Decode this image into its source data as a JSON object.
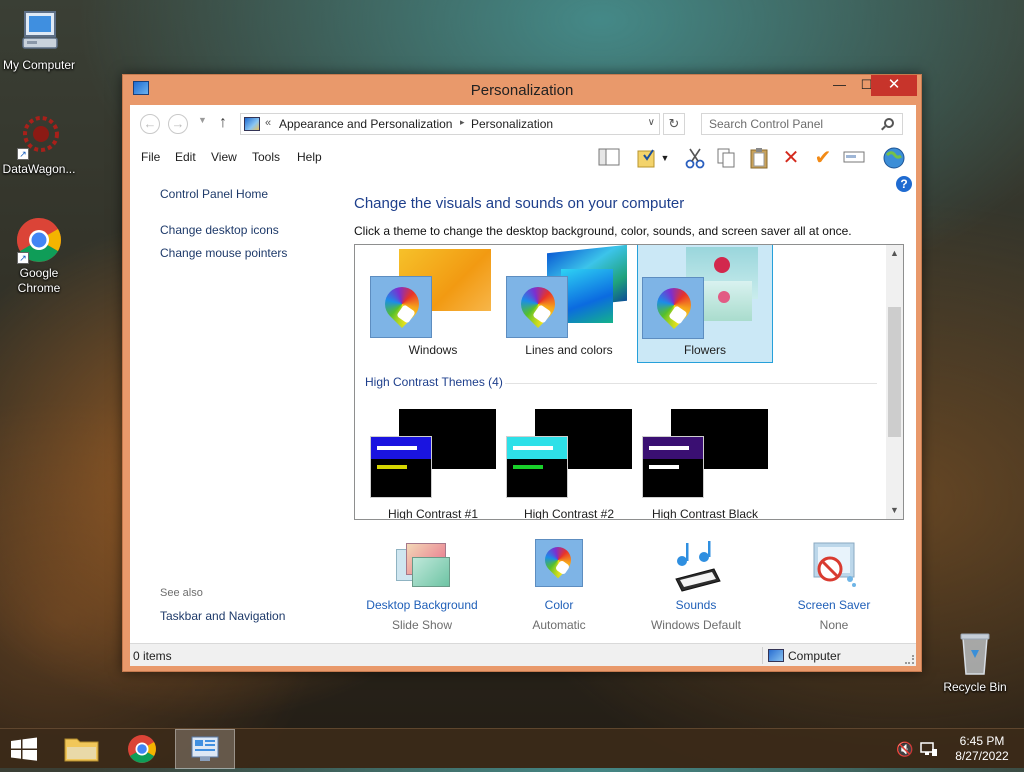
{
  "desktop": {
    "icons": [
      {
        "label": "My Computer"
      },
      {
        "label": "DataWagon..."
      },
      {
        "label": "Google Chrome"
      },
      {
        "label": "Recycle Bin"
      }
    ]
  },
  "window": {
    "title": "Personalization",
    "controls": {
      "minimize": "—",
      "maximize": "☐",
      "close": "✕"
    }
  },
  "address_bar": {
    "back_glyph": "←",
    "forward_glyph": "→",
    "up_glyph": "↑",
    "chevron": "«",
    "breadcrumb": [
      "Appearance and Personalization",
      "Personalization"
    ],
    "sep_glyph": "▸",
    "dropdown_glyph": "∨",
    "refresh_glyph": "↻",
    "search_placeholder": "Search Control Panel"
  },
  "menu": [
    "File",
    "Edit",
    "View",
    "Tools",
    "Help"
  ],
  "toolbar_icons": [
    "layout-icon",
    "folder-check-icon",
    "cut-icon",
    "copy-icon",
    "paste-icon",
    "delete-icon",
    "checkmark-icon",
    "rename-icon",
    "globe-icon"
  ],
  "left_pane": {
    "home": "Control Panel Home",
    "links": [
      "Change desktop icons",
      "Change mouse pointers"
    ],
    "see_also_title": "See also",
    "see_also_links": [
      "Taskbar and Navigation"
    ]
  },
  "main": {
    "heading": "Change the visuals and sounds on your computer",
    "subtext": "Click a theme to change the desktop background, color, sounds, and screen saver all at once.",
    "themes": [
      {
        "name": "Windows",
        "selected": false
      },
      {
        "name": "Lines and colors",
        "selected": false
      },
      {
        "name": "Flowers",
        "selected": true
      }
    ],
    "high_contrast_group": "High Contrast Themes (4)",
    "high_contrast_themes": [
      {
        "name": "High Contrast #1",
        "bar_color": "#1a14e0",
        "line1": "#ffffff",
        "line2": "#d6d600"
      },
      {
        "name": "High Contrast #2",
        "bar_color": "#2ee0e8",
        "line1": "#ffffff",
        "line2": "#19d02a"
      },
      {
        "name": "High Contrast Black",
        "bar_color": "#3a0f72",
        "line1": "#ffffff",
        "line2": "#ffffff"
      }
    ]
  },
  "tiles": [
    {
      "title": "Desktop Background",
      "sub": "Slide Show"
    },
    {
      "title": "Color",
      "sub": "Automatic"
    },
    {
      "title": "Sounds",
      "sub": "Windows Default"
    },
    {
      "title": "Screen Saver",
      "sub": "None"
    }
  ],
  "status": {
    "items": "0 items",
    "location": "Computer"
  },
  "taskbar": {
    "time": "6:45 PM",
    "date": "8/27/2022"
  },
  "colors": {
    "accent": "#1f5fb8",
    "window_frame": "#e9996b",
    "close_button": "#c7342b",
    "selection": "#cbe8f6"
  }
}
